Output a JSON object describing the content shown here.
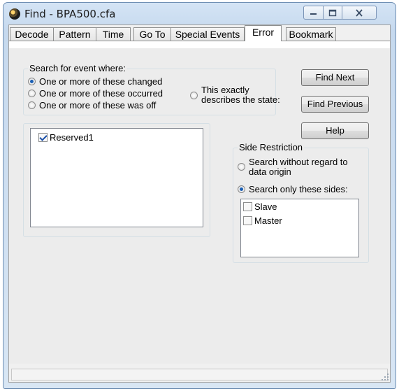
{
  "window": {
    "title": "Find - BPA500.cfa"
  },
  "tabs": [
    {
      "label": "Decode"
    },
    {
      "label": "Pattern"
    },
    {
      "label": "Time"
    },
    {
      "label": "Go To"
    },
    {
      "label": "Special Events"
    },
    {
      "label": "Error",
      "active": true
    },
    {
      "label": "Bookmark"
    }
  ],
  "search": {
    "group_title": "Search for event where:",
    "options": [
      {
        "label": "One or more of these changed",
        "selected": true
      },
      {
        "label": "One or more of these occurred",
        "selected": false
      },
      {
        "label": "One or more of these was off",
        "selected": false
      }
    ],
    "exact_option": {
      "label_line1": "This exactly",
      "label_line2": "describes the state:",
      "selected": false
    }
  },
  "buttons": {
    "find_next": "Find Next",
    "find_previous": "Find Previous",
    "help": "Help"
  },
  "events_list": [
    {
      "label": "Reserved1",
      "checked": true
    }
  ],
  "side_restriction": {
    "group_title": "Side Restriction",
    "option_any_line1": "Search without regard to",
    "option_any_line2": "data origin",
    "option_any_selected": false,
    "option_only": "Search only these sides:",
    "option_only_selected": true,
    "sides": [
      {
        "label": "Slave",
        "checked": false
      },
      {
        "label": "Master",
        "checked": false
      }
    ]
  },
  "icons": {
    "app": "app-globe-icon",
    "minimize": "minimize-icon",
    "maximize": "maximize-icon",
    "close": "close-icon",
    "grip": "resize-grip-icon"
  }
}
